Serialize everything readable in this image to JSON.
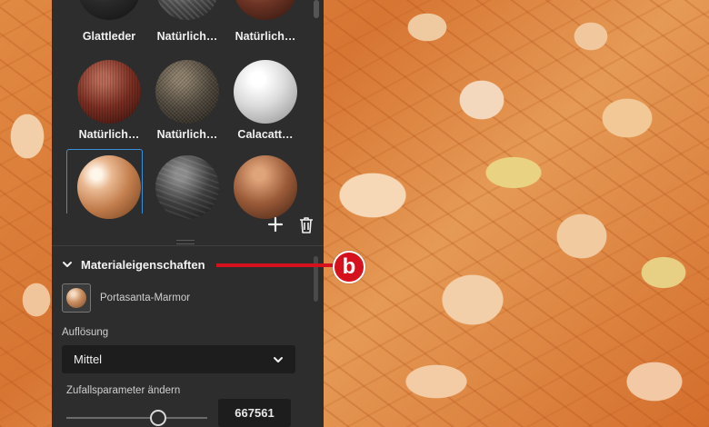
{
  "materials": [
    {
      "label": "Glattleder"
    },
    {
      "label": "Natürlich…"
    },
    {
      "label": "Natürlich…"
    },
    {
      "label": "Natürlich…"
    },
    {
      "label": "Natürlich…"
    },
    {
      "label": "Calacatt…"
    },
    {
      "label": ""
    },
    {
      "label": ""
    },
    {
      "label": ""
    }
  ],
  "toolbar": {
    "add_icon": "plus-icon",
    "delete_icon": "trash-icon"
  },
  "section": {
    "title": "Materialeigenschaften",
    "chevron": "chevron-down-icon"
  },
  "material": {
    "name": "Portasanta-Marmor"
  },
  "resolution": {
    "label": "Auflösung",
    "value": "Mittel"
  },
  "random": {
    "label": "Zufallsparameter ändern",
    "value": "667561",
    "slider_fraction": 0.72
  },
  "annotation": {
    "badge": "b",
    "color": "#d4111c"
  },
  "colors": {
    "panel": "#2d2d2d",
    "selection": "#3b8fd9"
  }
}
